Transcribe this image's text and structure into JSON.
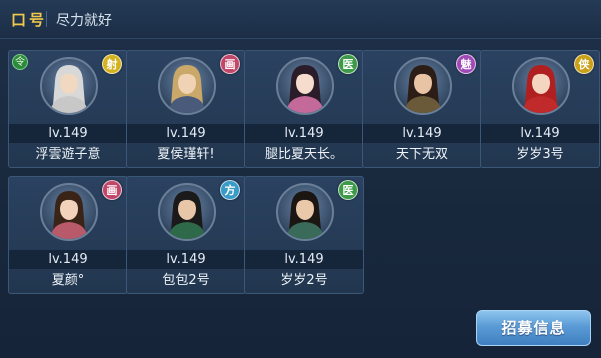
{
  "slogan": {
    "title": "口号",
    "text": "尽力就好"
  },
  "members": [
    {
      "level": "lv.149",
      "name": "浮雲遊子意",
      "badge": "射",
      "badge_color": "#d4b21e",
      "flag": "令",
      "hair": "#d8d8d8",
      "robe": "#c8c8c8",
      "skin": "#f1d8c0"
    },
    {
      "level": "lv.149",
      "name": "夏侯瑾轩!",
      "badge": "画",
      "badge_color": "#c0466a",
      "hair": "#c9a86a",
      "robe": "#4a5a7a",
      "skin": "#f0d2b4"
    },
    {
      "level": "lv.149",
      "name": "腿比夏天长。",
      "badge": "医",
      "badge_color": "#3c9a48",
      "hair": "#2a1c28",
      "robe": "#c36a9a",
      "skin": "#f5dccc"
    },
    {
      "level": "lv.149",
      "name": "天下无双",
      "badge": "魅",
      "badge_color": "#a04ab8",
      "hair": "#2c1e16",
      "robe": "#6a5a3a",
      "skin": "#e8c4a4"
    },
    {
      "level": "lv.149",
      "name": "岁岁3号",
      "badge": "侠",
      "badge_color": "#c9a018",
      "hair": "#b02020",
      "robe": "#c02a2a",
      "skin": "#f4d6c0"
    },
    {
      "level": "lv.149",
      "name": "夏颜°",
      "badge": "画",
      "badge_color": "#c0466a",
      "hair": "#3a2418",
      "robe": "#b85a6a",
      "skin": "#f3d2bc"
    },
    {
      "level": "lv.149",
      "name": "包包2号",
      "badge": "方",
      "badge_color": "#3a9ac8",
      "hair": "#1a1a1a",
      "robe": "#2e6a4a",
      "skin": "#e8c6a8"
    },
    {
      "level": "lv.149",
      "name": "岁岁2号",
      "badge": "医",
      "badge_color": "#3c9a48",
      "hair": "#1c1612",
      "robe": "#3a6a5a",
      "skin": "#eac8aa"
    }
  ],
  "recruit_button": "招募信息"
}
